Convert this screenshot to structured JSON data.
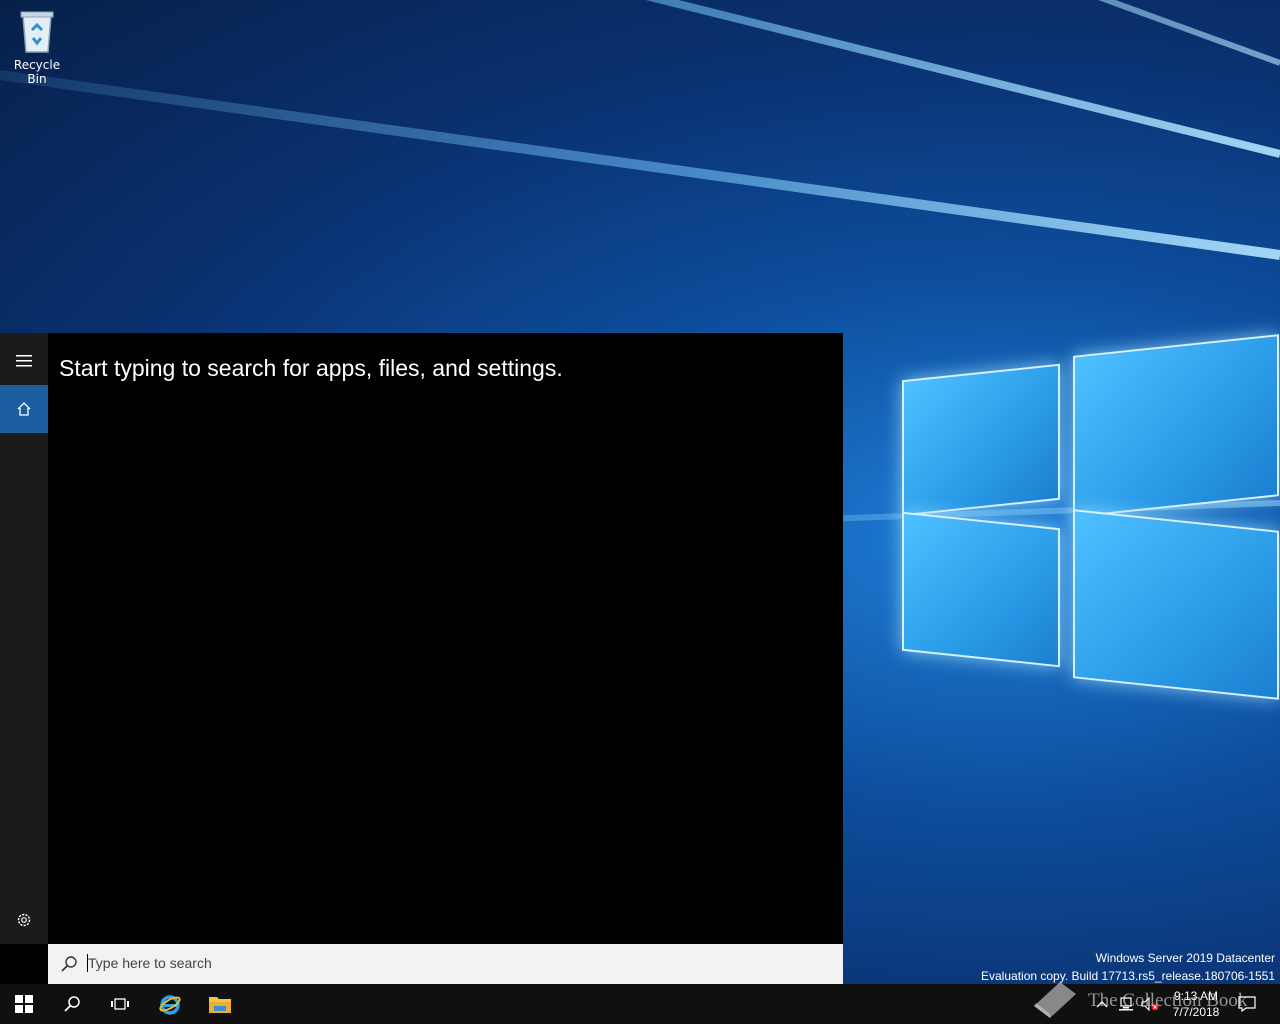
{
  "desktop": {
    "icons": [
      {
        "label": "Recycle Bin",
        "icon": "recycle-bin-icon"
      }
    ],
    "watermark": {
      "line1": "Windows Server 2019 Datacenter",
      "line2": "Evaluation copy. Build 17713.rs5_release.180706-1551"
    },
    "overlay_text": "The Collection Book"
  },
  "start_panel": {
    "hint": "Start typing to search for apps, files, and settings.",
    "nav": [
      {
        "icon": "hamburger-menu-icon"
      },
      {
        "icon": "home-icon",
        "selected": true
      },
      {
        "icon": "gear-icon"
      }
    ],
    "search": {
      "placeholder": "Type here to search"
    },
    "accent": "#1b5e9f"
  },
  "taskbar": {
    "buttons": [
      "windows-start-icon",
      "search-icon",
      "task-view-icon",
      "internet-explorer-icon",
      "file-explorer-icon"
    ],
    "tray": [
      "chevron-up-icon",
      "network-icon",
      "volume-muted-icon"
    ],
    "clock": {
      "time": "9:13 AM",
      "date": "7/7/2018"
    },
    "notifications": "action-center-icon"
  }
}
